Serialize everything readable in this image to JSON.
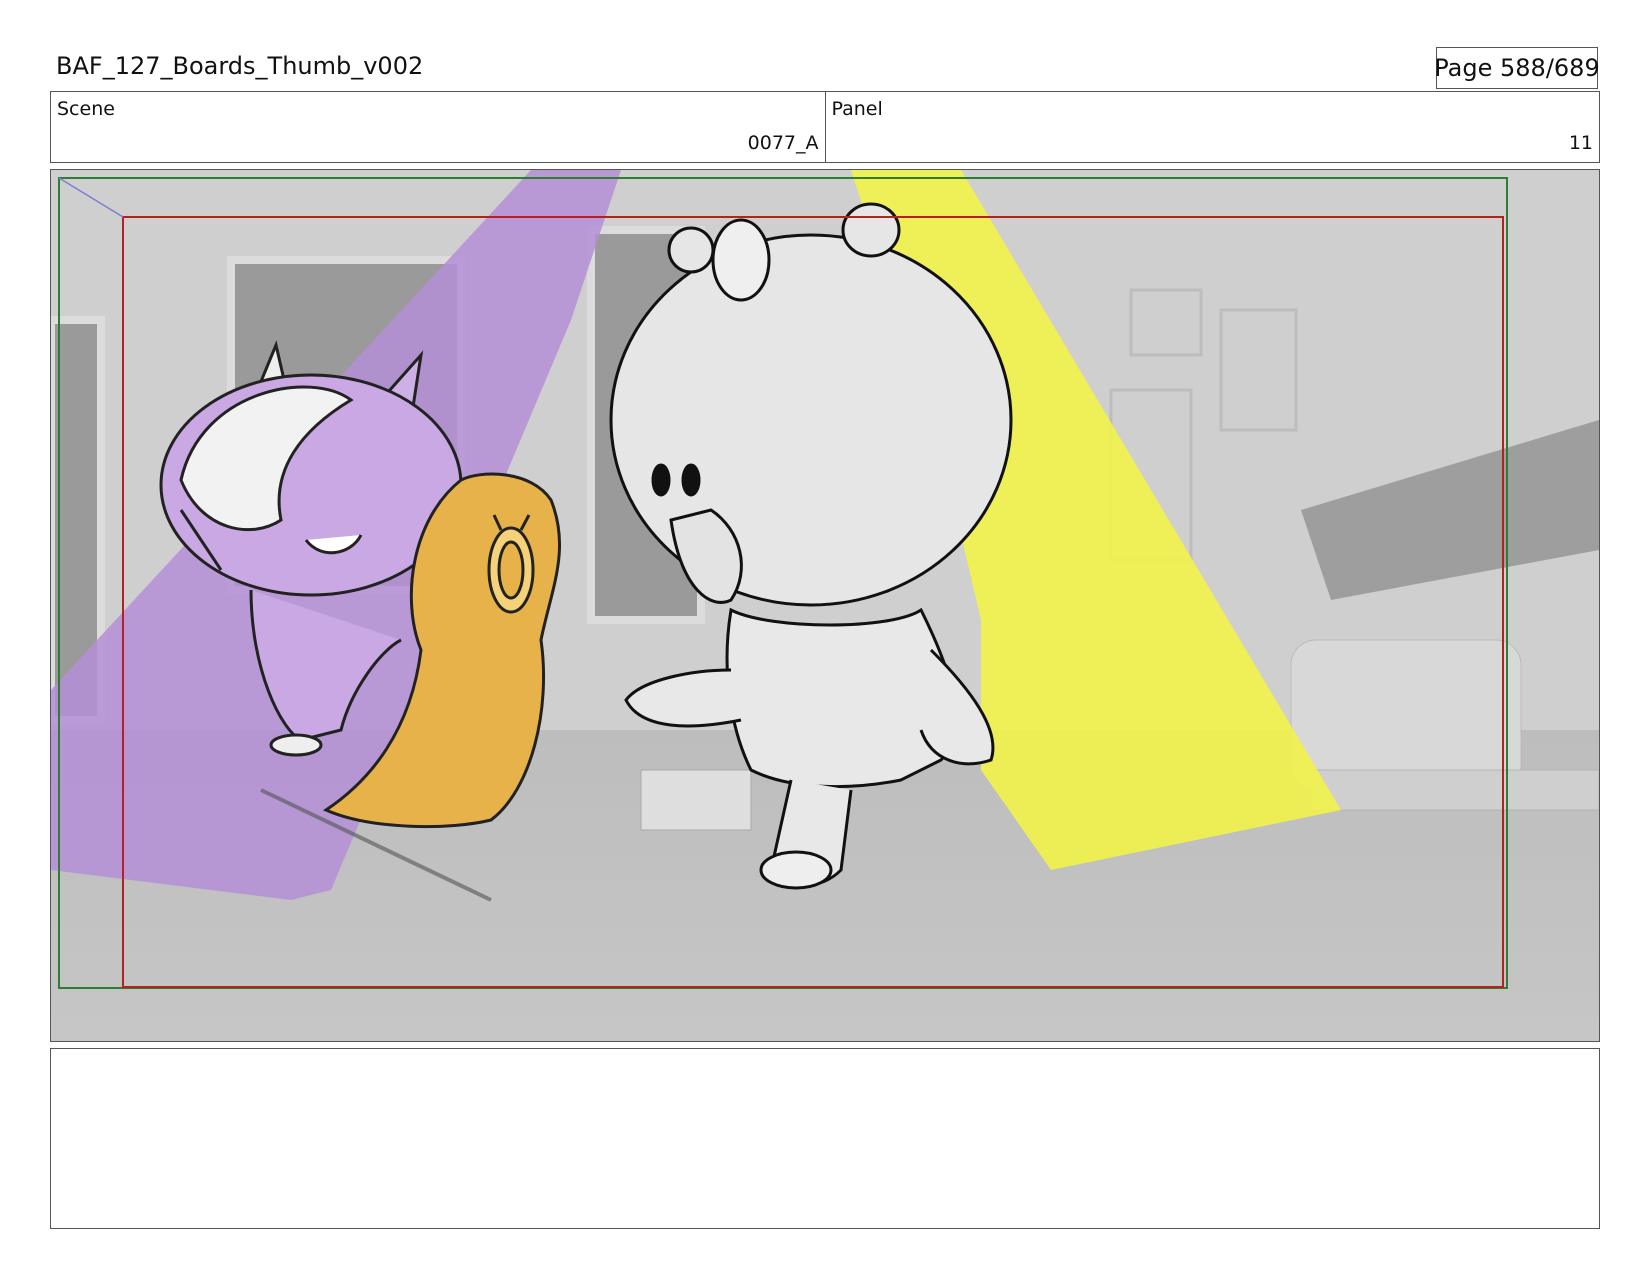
{
  "header": {
    "document_title": "BAF_127_Boards_Thumb_v002",
    "page_label": "Page 588/689"
  },
  "info": {
    "scene_label": "Scene",
    "scene_value": "0077_A",
    "panel_label": "Panel",
    "panel_value": "11"
  },
  "panel_image": {
    "description_icon": "storyboard-sketch",
    "colors": {
      "purple_light": "#b48fd6",
      "yellow_light": "#f2f24a",
      "bird_orange": "#e8b24a",
      "safe_frame_red": "#b22222",
      "camera_frame_green": "#2e7d32"
    }
  },
  "notes": {
    "text": ""
  }
}
